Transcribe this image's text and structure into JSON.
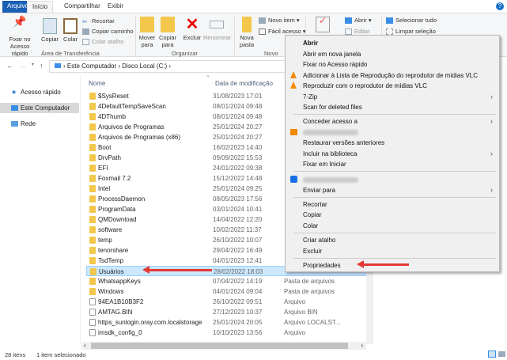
{
  "tabs": {
    "file": "Arquivo",
    "home": "Início",
    "share": "Compartilhar",
    "view": "Exibir"
  },
  "ribbon": {
    "pin": "Fixar no Acesso rápido",
    "copy": "Copiar",
    "paste": "Colar",
    "cut": "Recortar",
    "copy_path": "Copiar caminho",
    "paste_shortcut": "Colar atalho",
    "clipboard_group": "Área de Transferência",
    "move_to": "Mover para",
    "copy_to": "Copiar para",
    "delete": "Excluir",
    "rename": "Renomear",
    "organize_group": "Organizar",
    "new_folder": "Nova pasta",
    "new_item": "Novo item",
    "easy_access": "Fácil acesso",
    "new_group": "Novo",
    "open": "Abrir",
    "edit": "Editar",
    "select_all": "Selecionar tudo",
    "clear_selection": "Limpar seleção"
  },
  "breadcrumb": [
    "Este Computador",
    "Disco Local (C:)"
  ],
  "nav": [
    "Acesso rápido",
    "Este Computador",
    "Rede"
  ],
  "columns": {
    "name": "Nome",
    "date": "Data de modificação"
  },
  "files": [
    {
      "name": "$SysReset",
      "date": "31/08/2023 17:01",
      "type": "",
      "kind": "folder"
    },
    {
      "name": "4DefaultTempSaveScan",
      "date": "08/01/2024 09:48",
      "type": "",
      "kind": "folder"
    },
    {
      "name": "4DThumb",
      "date": "08/01/2024 09:48",
      "type": "",
      "kind": "folder"
    },
    {
      "name": "Arquivos de Programas",
      "date": "25/01/2024 20:27",
      "type": "",
      "kind": "folder"
    },
    {
      "name": "Arquivos de Programas (x86)",
      "date": "25/01/2024 20:27",
      "type": "",
      "kind": "folder"
    },
    {
      "name": "Boot",
      "date": "16/02/2023 14:40",
      "type": "",
      "kind": "folder"
    },
    {
      "name": "DrvPath",
      "date": "09/09/2022 15:53",
      "type": "",
      "kind": "folder"
    },
    {
      "name": "EFI",
      "date": "24/01/2022 09:38",
      "type": "",
      "kind": "folder"
    },
    {
      "name": "Foxmail 7.2",
      "date": "15/12/2022 14:48",
      "type": "",
      "kind": "folder"
    },
    {
      "name": "Intel",
      "date": "25/01/2024 09:25",
      "type": "",
      "kind": "folder"
    },
    {
      "name": "ProcessDaemon",
      "date": "08/05/2023 17:56",
      "type": "",
      "kind": "folder"
    },
    {
      "name": "ProgramData",
      "date": "03/01/2024 10:41",
      "type": "",
      "kind": "folder"
    },
    {
      "name": "QMDownload",
      "date": "14/04/2022 12:20",
      "type": "",
      "kind": "folder"
    },
    {
      "name": "software",
      "date": "10/02/2022 11:37",
      "type": "",
      "kind": "folder"
    },
    {
      "name": "temp",
      "date": "26/10/2022 10:07",
      "type": "",
      "kind": "folder"
    },
    {
      "name": "tenorshare",
      "date": "29/04/2022 16:49",
      "type": "",
      "kind": "folder"
    },
    {
      "name": "TsdTemp",
      "date": "04/01/2023 12:41",
      "type": "",
      "kind": "folder"
    },
    {
      "name": "Usuários",
      "date": "28/02/2022 18:03",
      "type": "",
      "kind": "folder"
    },
    {
      "name": "WhatsappKeys",
      "date": "07/04/2022 14:19",
      "type": "Pasta de arquivos",
      "kind": "folder"
    },
    {
      "name": "Windows",
      "date": "04/01/2024 09:04",
      "type": "Pasta de arquivos",
      "kind": "folder"
    },
    {
      "name": "94EA1B10B3F2",
      "date": "26/10/2022 09:51",
      "type": "Arquivo",
      "kind": "file"
    },
    {
      "name": "AMTAG.BIN",
      "date": "27/12/2023 10:37",
      "type": "Arquivo BIN",
      "kind": "file"
    },
    {
      "name": "https_sunlogin.oray.com.localstorage",
      "date": "25/01/2024 20:05",
      "type": "Arquivo LOCALST...",
      "kind": "file"
    },
    {
      "name": "imsdk_config_0",
      "date": "10/10/2023 13:56",
      "type": "Arquivo",
      "kind": "file"
    }
  ],
  "status": {
    "count": "28 itens",
    "selected": "1 item selecionado"
  },
  "menu": {
    "open": "Abrir",
    "open_new": "Abrir em nova janela",
    "pin": "Fixar no Acesso rápido",
    "vlc_add": "Adicionar à Lista de Reprodução do reprodutor de mídias VLC",
    "vlc_play": "Reproduzir com o reprodutor de mídias VLC",
    "zip": "7-Zip",
    "scan": "Scan for deleted files",
    "grant": "Conceder acesso a",
    "restore": "Restaurar versões anteriores",
    "library": "Incluir na biblioteca",
    "pin_start": "Fixar em Iniciar",
    "send_to": "Enviar para",
    "cut": "Recortar",
    "copy": "Copiar",
    "paste": "Colar",
    "shortcut": "Criar atalho",
    "delete": "Excluir",
    "properties": "Propriedades"
  }
}
